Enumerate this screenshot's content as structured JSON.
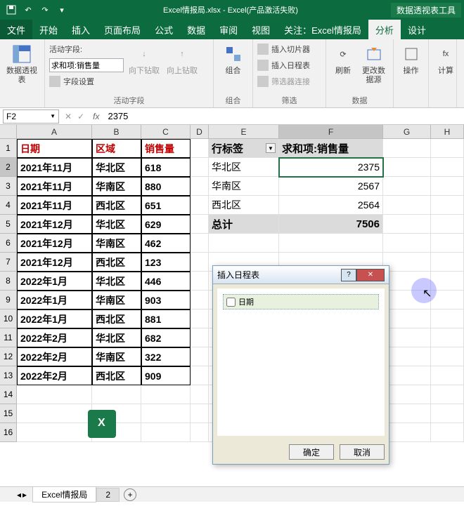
{
  "titlebar": {
    "filename": "Excel情报局.xlsx",
    "app": "Excel(产品激活失败)",
    "tool_context": "数据透视表工具"
  },
  "menu": {
    "file": "文件",
    "items": [
      "开始",
      "插入",
      "页面布局",
      "公式",
      "数据",
      "审阅",
      "视图",
      "关注：Excel情报局",
      "分析",
      "设计"
    ]
  },
  "ribbon": {
    "active_field_label": "活动字段:",
    "active_field_value": "求和项:销售量",
    "field_settings": "字段设置",
    "drill_down": "向下钻取",
    "drill_up": "向上钻取",
    "group_active_field": "活动字段",
    "group_btn": "组合",
    "group_group": "组合",
    "insert_slicer": "插入切片器",
    "insert_timeline": "插入日程表",
    "filter_conn": "筛选器连接",
    "group_filter": "筛选",
    "refresh": "刷新",
    "change_source": "更改数据源",
    "group_data": "数据",
    "actions": "操作",
    "calc": "计算",
    "pivot_table": "数据透视表"
  },
  "formula": {
    "name_box": "F2",
    "value": "2375"
  },
  "columns": [
    "A",
    "B",
    "C",
    "D",
    "E",
    "F",
    "G",
    "H"
  ],
  "data_headers": {
    "date": "日期",
    "region": "区域",
    "sales": "销售量"
  },
  "data_rows": [
    {
      "date": "2021年11月",
      "region": "华北区",
      "sales": "618"
    },
    {
      "date": "2021年11月",
      "region": "华南区",
      "sales": "880"
    },
    {
      "date": "2021年11月",
      "region": "西北区",
      "sales": "651"
    },
    {
      "date": "2021年12月",
      "region": "华北区",
      "sales": "629"
    },
    {
      "date": "2021年12月",
      "region": "华南区",
      "sales": "462"
    },
    {
      "date": "2021年12月",
      "region": "西北区",
      "sales": "123"
    },
    {
      "date": "2022年1月",
      "region": "华北区",
      "sales": "446"
    },
    {
      "date": "2022年1月",
      "region": "华南区",
      "sales": "903"
    },
    {
      "date": "2022年1月",
      "region": "西北区",
      "sales": "881"
    },
    {
      "date": "2022年2月",
      "region": "华北区",
      "sales": "682"
    },
    {
      "date": "2022年2月",
      "region": "华南区",
      "sales": "322"
    },
    {
      "date": "2022年2月",
      "region": "西北区",
      "sales": "909"
    }
  ],
  "pivot": {
    "row_label": "行标签",
    "sum_label": "求和项:销售量",
    "rows": [
      {
        "label": "华北区",
        "value": "2375"
      },
      {
        "label": "华南区",
        "value": "2567"
      },
      {
        "label": "西北区",
        "value": "2564"
      }
    ],
    "total_label": "总计",
    "total_value": "7506"
  },
  "dialog": {
    "title": "插入日程表",
    "item": "日期",
    "ok": "确定",
    "cancel": "取消"
  },
  "sheets": {
    "tab1": "Excel情报局",
    "tab2": "2"
  },
  "watermark": "Excel情报局"
}
